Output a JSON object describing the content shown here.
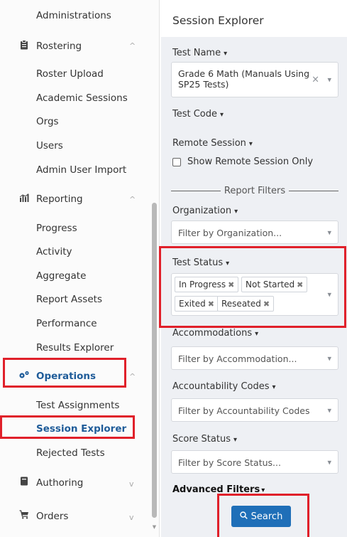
{
  "sidebar": {
    "items": [
      {
        "label": "Administrations"
      },
      {
        "label": "Rostering"
      },
      {
        "label": "Roster Upload"
      },
      {
        "label": "Academic Sessions"
      },
      {
        "label": "Orgs"
      },
      {
        "label": "Users"
      },
      {
        "label": "Admin User Import"
      },
      {
        "label": "Reporting"
      },
      {
        "label": "Progress"
      },
      {
        "label": "Activity"
      },
      {
        "label": "Aggregate"
      },
      {
        "label": "Report Assets"
      },
      {
        "label": "Performance"
      },
      {
        "label": "Results Explorer"
      },
      {
        "label": "Operations"
      },
      {
        "label": "Test Assignments"
      },
      {
        "label": "Session Explorer"
      },
      {
        "label": "Rejected Tests"
      },
      {
        "label": "Authoring"
      },
      {
        "label": "Orders"
      }
    ]
  },
  "panel": {
    "title": "Session Explorer",
    "test_name_label": "Test Name",
    "test_name_value": "Grade 6 Math (Manuals Using SP25 Tests)",
    "test_code_label": "Test Code",
    "remote_session_label": "Remote Session",
    "remote_checkbox_label": "Show Remote Session Only",
    "report_filters_label": "Report Filters",
    "organization_label": "Organization",
    "organization_placeholder": "Filter by Organization...",
    "test_status_label": "Test Status",
    "test_status_tags": [
      "In Progress",
      "Not Started",
      "Exited",
      "Reseated"
    ],
    "accommodations_label": "Accommodations",
    "accommodations_placeholder": "Filter by Accommodation...",
    "accountability_label": "Accountability Codes",
    "accountability_placeholder": "Filter by Accountability Codes",
    "score_status_label": "Score Status",
    "score_status_placeholder": "Filter by Score Status...",
    "advanced_filters_label": "Advanced Filters",
    "search_button_label": "Search"
  },
  "colors": {
    "accent": "#1f6fb8",
    "highlight": "#e0202a",
    "active_text": "#1f5c99"
  }
}
